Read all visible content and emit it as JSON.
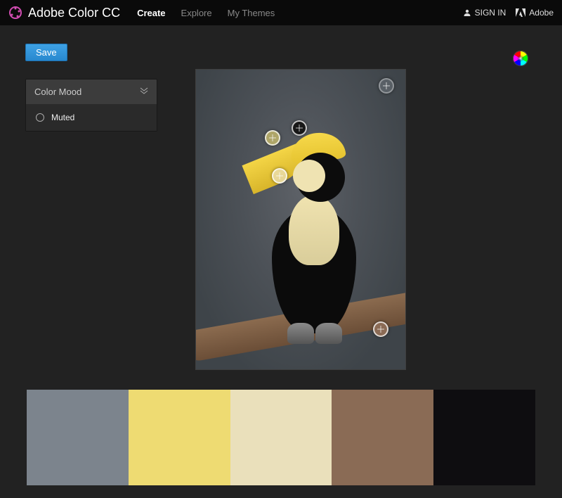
{
  "header": {
    "app_title": "Adobe Color CC",
    "nav": [
      {
        "label": "Create",
        "active": true
      },
      {
        "label": "Explore",
        "active": false
      },
      {
        "label": "My Themes",
        "active": false
      }
    ],
    "signin_label": "SIGN IN",
    "adobe_label": "Adobe"
  },
  "toolbar": {
    "save_label": "Save"
  },
  "panel": {
    "title": "Color Mood",
    "selected_option": "Muted"
  },
  "palette": {
    "swatches": [
      {
        "hex": "#7C848D"
      },
      {
        "hex": "#EEDB72"
      },
      {
        "hex": "#EAE0BB"
      },
      {
        "hex": "#8A6B55"
      },
      {
        "hex": "#0E0D10"
      }
    ]
  },
  "image_samples": [
    {
      "id": "s1",
      "note": "sky-gray"
    },
    {
      "id": "s2",
      "note": "casque-dark"
    },
    {
      "id": "s3",
      "note": "beak-yellow"
    },
    {
      "id": "s4",
      "note": "chest-cream"
    },
    {
      "id": "s5",
      "note": "branch-brown"
    }
  ]
}
